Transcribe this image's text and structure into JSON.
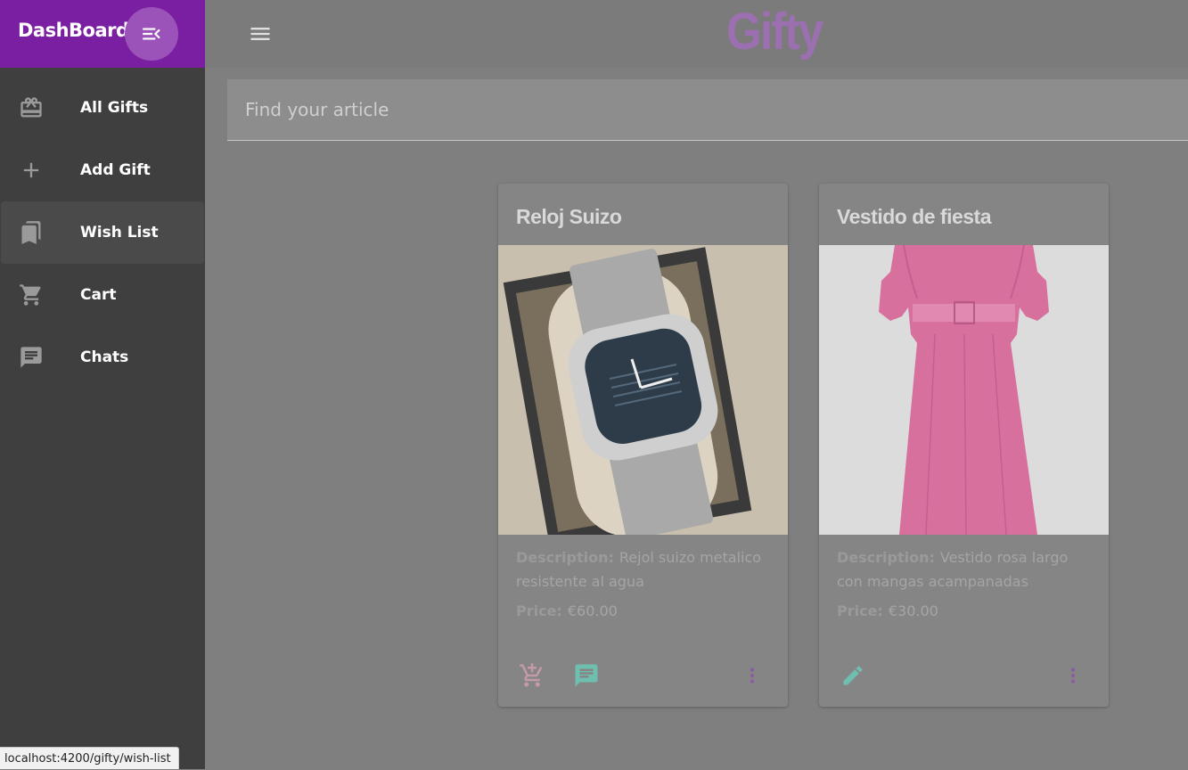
{
  "sidebar": {
    "title": "DashBoard",
    "items": [
      {
        "label": "All Gifts",
        "icon": "gift-icon"
      },
      {
        "label": "Add Gift",
        "icon": "plus-icon"
      },
      {
        "label": "Wish List",
        "icon": "bookmarks-icon",
        "active": true
      },
      {
        "label": "Cart",
        "icon": "cart-icon"
      },
      {
        "label": "Chats",
        "icon": "chat-icon"
      }
    ]
  },
  "header": {
    "brand": "Gifty"
  },
  "search": {
    "placeholder": "Find your article",
    "value": ""
  },
  "cards": [
    {
      "title": "Reloj Suizo",
      "description_label": "Description:",
      "description": "Rejol suizo metalico resistente al agua",
      "price_label": "Price:",
      "price": "€60.00",
      "actions": [
        "add-to-cart-icon",
        "chat-icon",
        "more-vert-icon"
      ]
    },
    {
      "title": "Vestido de fiesta",
      "description_label": "Description:",
      "description": "Vestido rosa largo con mangas acampanadas",
      "price_label": "Price:",
      "price": "€30.00",
      "actions": [
        "edit-icon",
        "more-vert-icon"
      ]
    }
  ],
  "status_bar": {
    "url": "localhost:4200/gifty/wish-list"
  },
  "colors": {
    "primary": "#7b1fa2",
    "brand": "#9b6fb0",
    "accent_teal": "#6fbfb0",
    "cart_pink": "#c49aa8"
  }
}
